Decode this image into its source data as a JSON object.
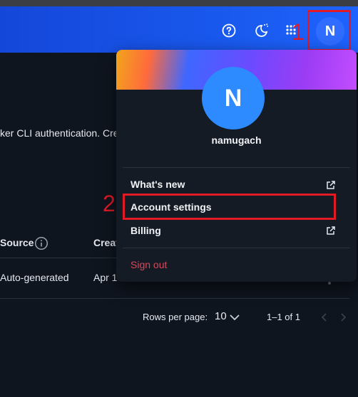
{
  "background": {
    "description_text": "ker CLI authentication. Cre",
    "columns": {
      "source": "Source",
      "created": "Creat"
    },
    "row": {
      "source": "Auto-generated",
      "created": "Apr 1"
    },
    "pagination": {
      "rows_per_page_label": "Rows per page:",
      "rows_per_page_value": "10",
      "range": "1–1 of 1"
    }
  },
  "header": {
    "icons": [
      "help-icon",
      "theme-icon",
      "apps-grid-icon"
    ],
    "avatar_initial": "N"
  },
  "account_menu": {
    "avatar_initial": "N",
    "username": "namugach",
    "items": [
      {
        "label": "What's new"
      },
      {
        "label": "Account settings"
      },
      {
        "label": "Billing"
      }
    ],
    "sign_out": "Sign out"
  },
  "annotations": {
    "step1": "1",
    "step2": "2"
  },
  "colors": {
    "header": "#1a5bf0",
    "avatar": "#2e8bff",
    "annotation": "#e21a26",
    "signout": "#d9475a"
  }
}
